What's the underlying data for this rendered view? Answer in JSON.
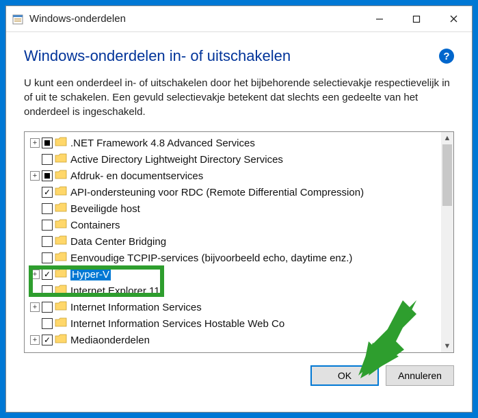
{
  "window": {
    "title": "Windows-onderdelen"
  },
  "heading": "Windows-onderdelen in- of uitschakelen",
  "description": "U kunt een onderdeel in- of uitschakelen door het bijbehorende selectievakje respectievelijk in of uit te schakelen. Een gevuld selectievakje betekent dat slechts een gedeelte van het onderdeel is ingeschakeld.",
  "items": [
    {
      "expand": "+",
      "check": "partial",
      "label": ".NET Framework 4.8 Advanced Services",
      "selected": false
    },
    {
      "expand": "",
      "check": "",
      "label": "Active Directory Lightweight Directory Services",
      "selected": false
    },
    {
      "expand": "+",
      "check": "partial",
      "label": "Afdruk- en documentservices",
      "selected": false
    },
    {
      "expand": "",
      "check": "checked",
      "label": "API-ondersteuning voor RDC (Remote Differential Compression)",
      "selected": false
    },
    {
      "expand": "",
      "check": "",
      "label": "Beveiligde host",
      "selected": false
    },
    {
      "expand": "",
      "check": "",
      "label": "Containers",
      "selected": false
    },
    {
      "expand": "",
      "check": "",
      "label": "Data Center Bridging",
      "selected": false
    },
    {
      "expand": "",
      "check": "",
      "label": "Eenvoudige TCPIP-services (bijvoorbeeld echo, daytime enz.)",
      "selected": false
    },
    {
      "expand": "+",
      "check": "checked",
      "label": "Hyper-V",
      "selected": true
    },
    {
      "expand": "",
      "check": "",
      "label": "Internet Explorer 11",
      "selected": false
    },
    {
      "expand": "+",
      "check": "",
      "label": "Internet Information Services",
      "selected": false
    },
    {
      "expand": "",
      "check": "",
      "label": "Internet Information Services Hostable Web Co",
      "selected": false
    },
    {
      "expand": "+",
      "check": "checked",
      "label": "Mediaonderdelen",
      "selected": false
    }
  ],
  "buttons": {
    "ok": "OK",
    "cancel": "Annuleren"
  }
}
